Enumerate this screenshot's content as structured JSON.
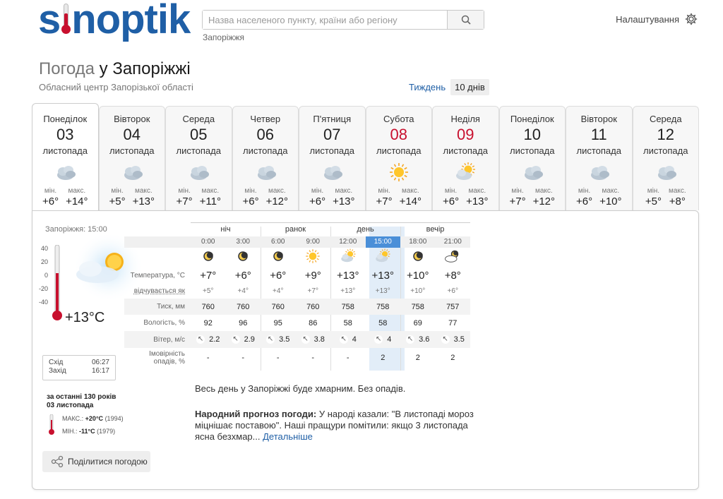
{
  "header": {
    "logo_pre": "s",
    "logo_post": "noptik",
    "search_placeholder": "Назва населеного пункту, країни або регіону",
    "city_hint": "Запоріжжя",
    "settings_label": "Налаштування"
  },
  "title": {
    "prefix": "Погода",
    "city": "у Запоріжжі",
    "subtitle": "Обласний центр Запорізької області"
  },
  "period": {
    "week": "Тиждень",
    "ten_days": "10 днів"
  },
  "days": [
    {
      "name": "Понеділок",
      "num": "03",
      "month": "листопада",
      "icon": "cloudy-icon",
      "min_label": "мін.",
      "max_label": "макс.",
      "min": "+6°",
      "max": "+14°",
      "weekend": false
    },
    {
      "name": "Вівторок",
      "num": "04",
      "month": "листопада",
      "icon": "cloudy-icon",
      "min_label": "мін.",
      "max_label": "макс.",
      "min": "+5°",
      "max": "+13°",
      "weekend": false
    },
    {
      "name": "Середа",
      "num": "05",
      "month": "листопада",
      "icon": "cloudy-icon",
      "min_label": "мін.",
      "max_label": "макс.",
      "min": "+7°",
      "max": "+11°",
      "weekend": false
    },
    {
      "name": "Четвер",
      "num": "06",
      "month": "листопада",
      "icon": "cloudy-icon",
      "min_label": "мін.",
      "max_label": "макс.",
      "min": "+6°",
      "max": "+12°",
      "weekend": false
    },
    {
      "name": "П'ятниця",
      "num": "07",
      "month": "листопада",
      "icon": "cloudy-icon",
      "min_label": "мін.",
      "max_label": "макс.",
      "min": "+6°",
      "max": "+13°",
      "weekend": false
    },
    {
      "name": "Субота",
      "num": "08",
      "month": "листопада",
      "icon": "sun-icon",
      "min_label": "мін.",
      "max_label": "макс.",
      "min": "+7°",
      "max": "+14°",
      "weekend": true
    },
    {
      "name": "Неділя",
      "num": "09",
      "month": "листопада",
      "icon": "sun-cloud-icon",
      "min_label": "мін.",
      "max_label": "макс.",
      "min": "+6°",
      "max": "+13°",
      "weekend": true
    },
    {
      "name": "Понеділок",
      "num": "10",
      "month": "листопада",
      "icon": "cloudy-icon",
      "min_label": "мін.",
      "max_label": "макс.",
      "min": "+7°",
      "max": "+12°",
      "weekend": false
    },
    {
      "name": "Вівторок",
      "num": "11",
      "month": "листопада",
      "icon": "cloudy-icon",
      "min_label": "мін.",
      "max_label": "макс.",
      "min": "+6°",
      "max": "+10°",
      "weekend": false
    },
    {
      "name": "Середа",
      "num": "12",
      "month": "листопада",
      "icon": "cloudy-icon",
      "min_label": "мін.",
      "max_label": "макс.",
      "min": "+5°",
      "max": "+8°",
      "weekend": false
    }
  ],
  "now": {
    "title": "Запоріжжя: 15:00",
    "scale": [
      "40",
      "20",
      "0",
      "-20",
      "-40"
    ],
    "temp": "+13°C",
    "sunrise_label": "Схід",
    "sunrise": "06:27",
    "sunset_label": "Захід",
    "sunset": "16:17",
    "hist_title": "за останні 130 років",
    "hist_date": "03 листопада",
    "hist_max_label": "МАКС.:",
    "hist_max": "+20°C",
    "hist_max_year": "(1994)",
    "hist_min_label": "МІН.:",
    "hist_min": "-11°C",
    "hist_min_year": "(1979)",
    "share_label": "Поділитися погодою"
  },
  "hourly": {
    "periods": [
      "ніч",
      "ранок",
      "день",
      "вечір"
    ],
    "times": [
      "0:00",
      "3:00",
      "6:00",
      "9:00",
      "12:00",
      "15:00",
      "18:00",
      "21:00"
    ],
    "icons": [
      "moon-icon",
      "moon-icon",
      "moon-icon",
      "sun-icon",
      "sun-cloud-icon",
      "sun-cloud-icon",
      "moon-icon",
      "moon-cloud-icon"
    ],
    "row_labels": {
      "temp": "Температура, °С",
      "feels": "відчувається як",
      "pressure": "Тиск, мм",
      "humidity": "Вологість, %",
      "wind": "Вітер, м/с",
      "precip": "Імовірність опадів, %"
    },
    "temp": [
      "+7°",
      "+6°",
      "+6°",
      "+9°",
      "+13°",
      "+13°",
      "+10°",
      "+8°"
    ],
    "feels": [
      "+5°",
      "+4°",
      "+4°",
      "+7°",
      "+13°",
      "+13°",
      "+10°",
      "+6°"
    ],
    "pressure": [
      "760",
      "760",
      "760",
      "760",
      "758",
      "758",
      "758",
      "757"
    ],
    "humidity": [
      "92",
      "96",
      "95",
      "86",
      "58",
      "58",
      "69",
      "77"
    ],
    "wind": [
      "2.2",
      "2.9",
      "3.5",
      "3.8",
      "4",
      "4",
      "3.6",
      "3.5"
    ],
    "precip": [
      "-",
      "-",
      "-",
      "-",
      "-",
      "2",
      "2",
      "2"
    ]
  },
  "description": "Весь день у Запоріжжі буде хмарним. Без опадів.",
  "folk": {
    "label": "Народний прогноз погоди:",
    "text": " У народі казали: \"В листопаді мороз міцнішає поставою\". Наші пращури помітили: якщо 3 листопада ясна безхмар...",
    "more": "Детальніше"
  }
}
